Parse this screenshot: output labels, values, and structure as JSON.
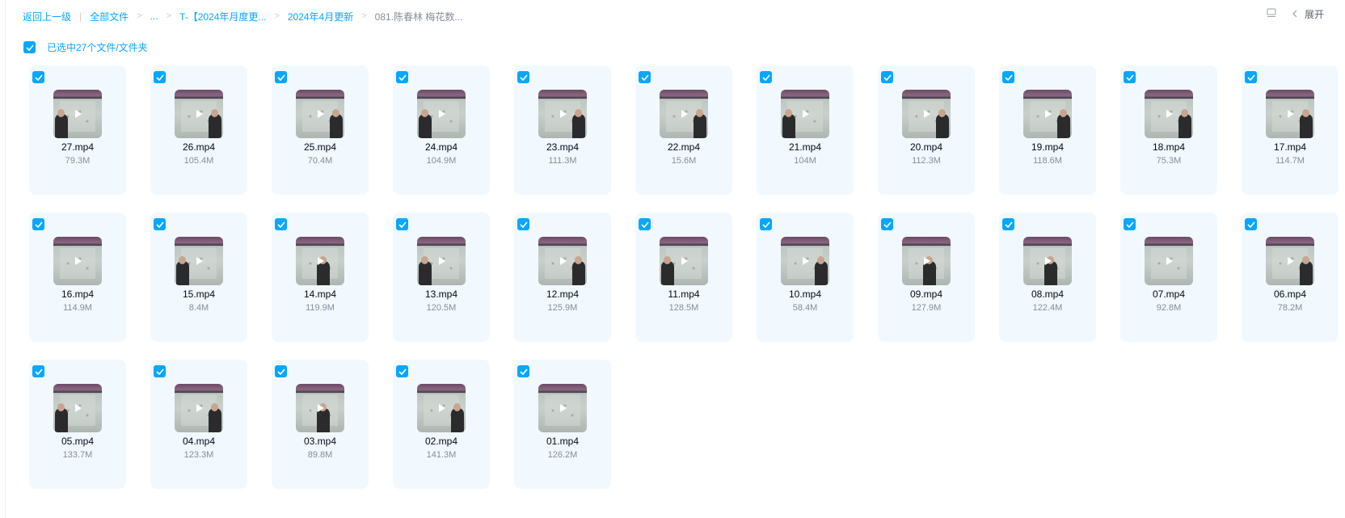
{
  "breadcrumb": {
    "back": "返回上一级",
    "all_files": "全部文件",
    "ellipsis": "...",
    "folder1": "T-【2024年月度更...",
    "folder2": "2024年4月更新",
    "current": "081.陈春林 梅花数..."
  },
  "toolbar": {
    "expand_label": "展开"
  },
  "selection": {
    "label": "已选中27个文件/文件夹",
    "checked": true
  },
  "colors": {
    "accent": "#06a7ff",
    "card_bg": "#f1f9ff",
    "muted_text": "#878c9c"
  },
  "files": [
    {
      "name": "27.mp4",
      "size": "79.3M",
      "checked": true
    },
    {
      "name": "26.mp4",
      "size": "105.4M",
      "checked": true
    },
    {
      "name": "25.mp4",
      "size": "70.4M",
      "checked": true
    },
    {
      "name": "24.mp4",
      "size": "104.9M",
      "checked": true
    },
    {
      "name": "23.mp4",
      "size": "111.3M",
      "checked": true
    },
    {
      "name": "22.mp4",
      "size": "15.6M",
      "checked": true
    },
    {
      "name": "21.mp4",
      "size": "104M",
      "checked": true
    },
    {
      "name": "20.mp4",
      "size": "112.3M",
      "checked": true
    },
    {
      "name": "19.mp4",
      "size": "118.6M",
      "checked": true
    },
    {
      "name": "18.mp4",
      "size": "75.3M",
      "checked": true
    },
    {
      "name": "17.mp4",
      "size": "114.7M",
      "checked": true
    },
    {
      "name": "16.mp4",
      "size": "114.9M",
      "checked": true
    },
    {
      "name": "15.mp4",
      "size": "8.4M",
      "checked": true
    },
    {
      "name": "14.mp4",
      "size": "119.9M",
      "checked": true
    },
    {
      "name": "13.mp4",
      "size": "120.5M",
      "checked": true
    },
    {
      "name": "12.mp4",
      "size": "125.9M",
      "checked": true
    },
    {
      "name": "11.mp4",
      "size": "128.5M",
      "checked": true
    },
    {
      "name": "10.mp4",
      "size": "58.4M",
      "checked": true
    },
    {
      "name": "09.mp4",
      "size": "127.9M",
      "checked": true
    },
    {
      "name": "08.mp4",
      "size": "122.4M",
      "checked": true
    },
    {
      "name": "07.mp4",
      "size": "92.8M",
      "checked": true
    },
    {
      "name": "06.mp4",
      "size": "78.2M",
      "checked": true
    },
    {
      "name": "05.mp4",
      "size": "133.7M",
      "checked": true
    },
    {
      "name": "04.mp4",
      "size": "123.3M",
      "checked": true
    },
    {
      "name": "03.mp4",
      "size": "89.8M",
      "checked": true
    },
    {
      "name": "02.mp4",
      "size": "141.3M",
      "checked": true
    },
    {
      "name": "01.mp4",
      "size": "126.2M",
      "checked": true
    }
  ]
}
